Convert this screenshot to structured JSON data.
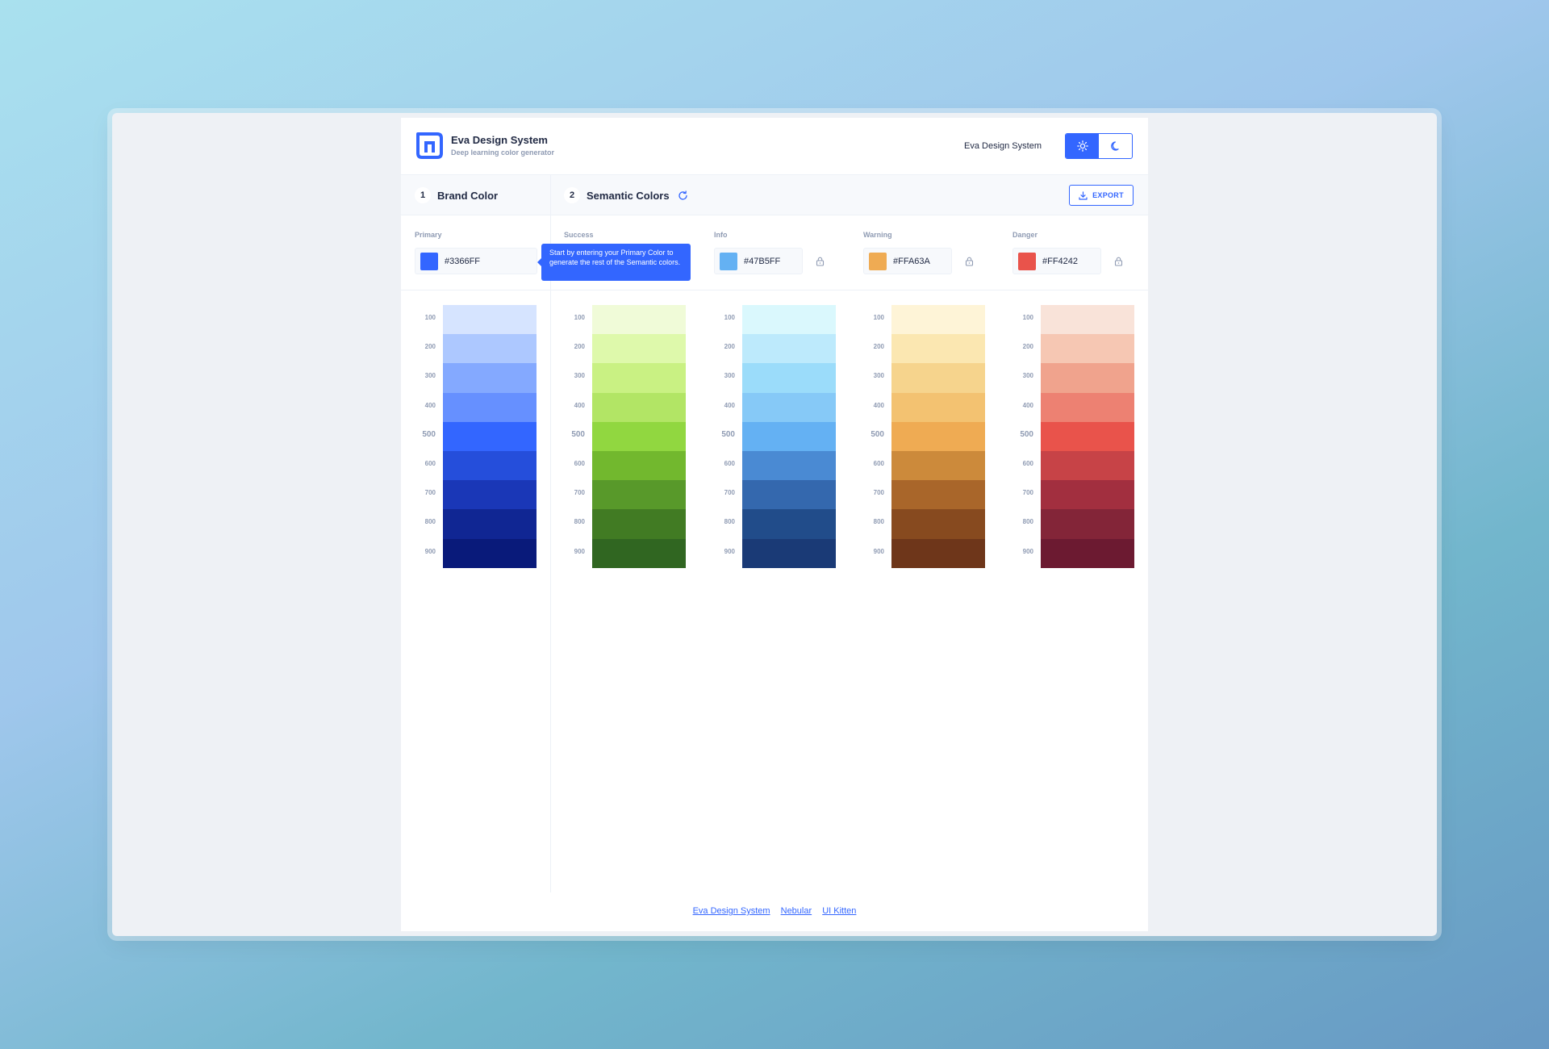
{
  "header": {
    "brand_title": "Eva Design System",
    "brand_subtitle": "Deep learning color generator",
    "link": "Eva Design System"
  },
  "sections": [
    {
      "num": "1",
      "label": "Brand Color"
    },
    {
      "num": "2",
      "label": "Semantic Colors"
    }
  ],
  "export_label": "EXPORT",
  "tooltip": "Start by entering your Primary Color to generate the rest of the Semantic colors.",
  "shade_labels": [
    "100",
    "200",
    "300",
    "400",
    "500",
    "600",
    "700",
    "800",
    "900"
  ],
  "colors": [
    {
      "label": "Primary",
      "hex": "#3366FF",
      "shades": [
        "#d6e4ff",
        "#adc8ff",
        "#84a9ff",
        "#6690ff",
        "#3366ff",
        "#254edb",
        "#1a37b7",
        "#102693",
        "#091a7a"
      ]
    },
    {
      "label": "Success",
      "hex": "",
      "shades": [
        "#f0fbd8",
        "#def9ab",
        "#c9f183",
        "#b2e565",
        "#91d740",
        "#72b82e",
        "#58992a",
        "#417b23",
        "#306621"
      ]
    },
    {
      "label": "Info",
      "hex": "#47B5FF",
      "shades": [
        "#daf8fd",
        "#bdeafc",
        "#9bdcfa",
        "#86c9f7",
        "#64b1f3",
        "#4a8ad3",
        "#3468ae",
        "#214c8a",
        "#1a3a76"
      ]
    },
    {
      "label": "Warning",
      "hex": "#FFA63A",
      "shades": [
        "#fef4d7",
        "#fbe7b1",
        "#f6d48d",
        "#f3c271",
        "#efab53",
        "#cc8a3b",
        "#a9662a",
        "#874a1f",
        "#6e361a"
      ]
    },
    {
      "label": "Danger",
      "hex": "#FF4242",
      "shades": [
        "#f9e3d9",
        "#f6c7b3",
        "#f0a38d",
        "#ed8172",
        "#e9534b",
        "#c74347",
        "#a22f3f",
        "#832538",
        "#6c1a31"
      ]
    }
  ],
  "footer_links": [
    "Eva Design System",
    "Nebular",
    "UI Kitten"
  ]
}
